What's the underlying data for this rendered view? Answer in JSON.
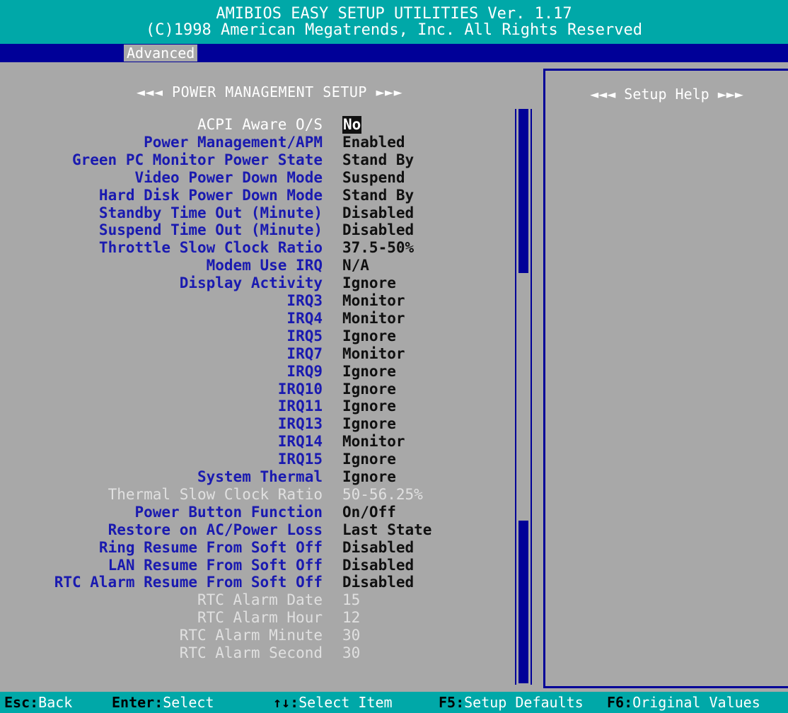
{
  "title": {
    "line1": "AMIBIOS EASY SETUP UTILITIES Ver. 1.17",
    "line2": "(C)1998 American Megatrends, Inc. All Rights Reserved"
  },
  "menu": {
    "active": "Advanced"
  },
  "section_title": "◄◄◄ POWER MANAGEMENT SETUP ►►►",
  "help_title": "◄◄◄ Setup Help ►►►",
  "settings": [
    {
      "label": "ACPI Aware O/S",
      "value": "No",
      "state": "header-selected"
    },
    {
      "label": "Power Management/APM",
      "value": "Enabled",
      "state": "normal"
    },
    {
      "label": "Green PC Monitor Power State",
      "value": "Stand By",
      "state": "normal"
    },
    {
      "label": "Video Power Down Mode",
      "value": "Suspend",
      "state": "normal"
    },
    {
      "label": "Hard Disk Power Down Mode",
      "value": "Stand By",
      "state": "normal"
    },
    {
      "label": "Standby Time Out (Minute)",
      "value": "Disabled",
      "state": "normal"
    },
    {
      "label": "Suspend Time Out (Minute)",
      "value": "Disabled",
      "state": "normal"
    },
    {
      "label": "Throttle Slow Clock Ratio",
      "value": "37.5-50%",
      "state": "normal"
    },
    {
      "label": "Modem Use IRQ",
      "value": "N/A",
      "state": "normal"
    },
    {
      "label": "Display Activity",
      "value": "Ignore",
      "state": "normal"
    },
    {
      "label": "IRQ3",
      "value": "Monitor",
      "state": "normal"
    },
    {
      "label": "IRQ4",
      "value": "Monitor",
      "state": "normal"
    },
    {
      "label": "IRQ5",
      "value": "Ignore",
      "state": "normal"
    },
    {
      "label": "IRQ7",
      "value": "Monitor",
      "state": "normal"
    },
    {
      "label": "IRQ9",
      "value": "Ignore",
      "state": "normal"
    },
    {
      "label": "IRQ10",
      "value": "Ignore",
      "state": "normal"
    },
    {
      "label": "IRQ11",
      "value": "Ignore",
      "state": "normal"
    },
    {
      "label": "IRQ13",
      "value": "Ignore",
      "state": "normal"
    },
    {
      "label": "IRQ14",
      "value": "Monitor",
      "state": "normal"
    },
    {
      "label": "IRQ15",
      "value": "Ignore",
      "state": "normal"
    },
    {
      "label": "System Thermal",
      "value": "Ignore",
      "state": "normal"
    },
    {
      "label": "Thermal Slow Clock Ratio",
      "value": "50-56.25%",
      "state": "disabled"
    },
    {
      "label": "Power Button Function",
      "value": "On/Off",
      "state": "normal"
    },
    {
      "label": "Restore on AC/Power Loss",
      "value": "Last State",
      "state": "normal"
    },
    {
      "label": "Ring Resume From Soft Off",
      "value": "Disabled",
      "state": "normal"
    },
    {
      "label": "LAN Resume From Soft Off",
      "value": "Disabled",
      "state": "normal"
    },
    {
      "label": "RTC Alarm Resume From Soft Off",
      "value": "Disabled",
      "state": "normal"
    },
    {
      "label": "RTC Alarm Date",
      "value": "15",
      "state": "disabled"
    },
    {
      "label": "RTC Alarm Hour",
      "value": "12",
      "state": "disabled"
    },
    {
      "label": "RTC Alarm Minute",
      "value": "30",
      "state": "disabled"
    },
    {
      "label": "RTC Alarm Second",
      "value": "30",
      "state": "disabled"
    }
  ],
  "statusbar": [
    {
      "key": "Esc",
      "action": "Back"
    },
    {
      "key": "Enter",
      "action": "Select"
    },
    {
      "key": "↑↓",
      "action": "Select Item"
    },
    {
      "key": "F5",
      "action": "Setup Defaults"
    },
    {
      "key": "F6",
      "action": "Original Values"
    }
  ],
  "colors": {
    "title_bg": "#00a8a8",
    "menubar_bg": "#000098",
    "panel_bg": "#a8a8a8",
    "label_blue": "#1a1ab0"
  }
}
